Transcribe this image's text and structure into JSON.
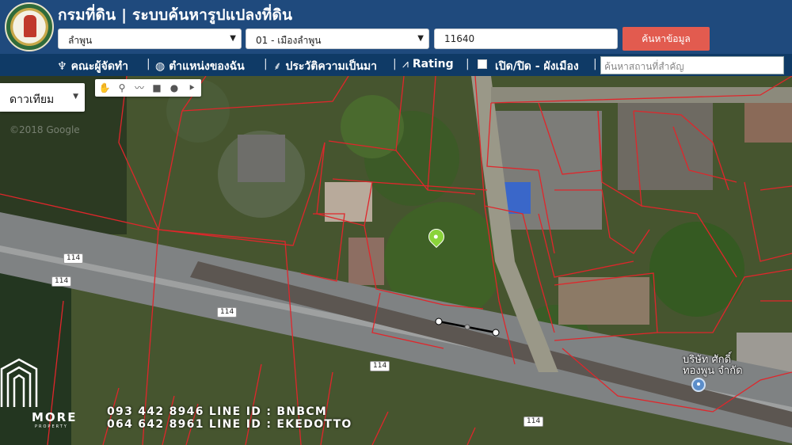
{
  "header": {
    "title": "กรมที่ดิน | ระบบค้นหารูปแปลงที่ดิน",
    "province": "ลำพูน",
    "district": "01 - เมืองลำพูน",
    "postcode": "11640",
    "search_button": "ค้นหาข้อมูล",
    "theme_color": "#1f4a7d",
    "button_color": "#e25b4f"
  },
  "menu": {
    "items": [
      {
        "label": "คณะผู้จัดทำ",
        "icon": "group-icon"
      },
      {
        "label": "ตำแหน่งของฉัน",
        "icon": "globe-icon"
      },
      {
        "label": "ประวัติความเป็นมา",
        "icon": "history-icon"
      },
      {
        "label": "Rating",
        "icon": "chart-icon"
      },
      {
        "label": "เปิด/ปิด - ผังเมือง",
        "icon": "checkbox-icon"
      }
    ],
    "place_search_placeholder": "ค้นหาสถานที่สำคัญ"
  },
  "map": {
    "map_type": "ดาวเทียม",
    "tools": [
      "hand-icon",
      "marker-tool-icon",
      "polyline-icon",
      "rectangle-icon",
      "circle-icon",
      "polygon-icon"
    ],
    "copyright": "©2018 Google",
    "road_labels": [
      "114",
      "114",
      "114",
      "114",
      "114"
    ],
    "company_label_line1": "บริษัท ศักดิ์",
    "company_label_line2": "ทองพูน จำกัด",
    "parcel_line_color": "#e0262b"
  },
  "watermark": {
    "brand": "MORE",
    "sub": "PROPERTY",
    "phone1": "093 442 8946 LINE ID : BNBCM",
    "phone2": "064 642 8961  LINE ID : EKEDOTTO"
  }
}
